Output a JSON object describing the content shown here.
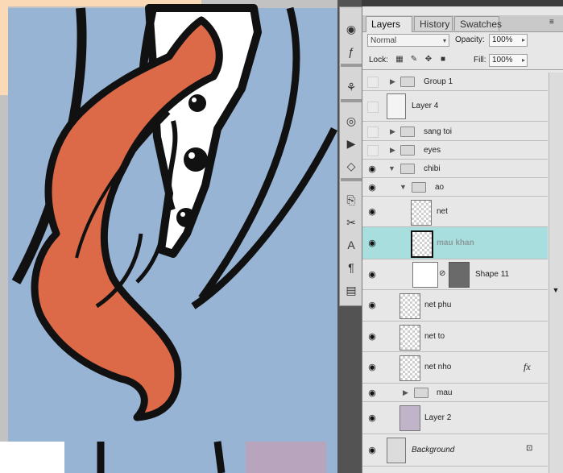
{
  "tabs": [
    {
      "label": "Layers",
      "close": "×"
    },
    {
      "label": "History"
    },
    {
      "label": "Swatches"
    }
  ],
  "options": {
    "blend_mode": "Normal",
    "opacity_label": "Opacity:",
    "opacity_value": "100%",
    "lock_label": "Lock:",
    "fill_label": "Fill:",
    "fill_value": "100%"
  },
  "layers": [
    {
      "name": "Group 1",
      "type": "group",
      "visible": false
    },
    {
      "name": "Layer 4",
      "type": "layer",
      "visible": false
    },
    {
      "name": "sang toi",
      "type": "group",
      "visible": false
    },
    {
      "name": "eyes",
      "type": "group",
      "visible": false
    },
    {
      "name": "chibi",
      "type": "group",
      "visible": true,
      "expanded": true
    },
    {
      "name": "ao",
      "type": "group",
      "visible": true,
      "expanded": true
    },
    {
      "name": "net",
      "type": "layer",
      "visible": true
    },
    {
      "name": "mau khan",
      "type": "layer",
      "visible": true,
      "selected": true
    },
    {
      "name": "Shape 11",
      "type": "shape",
      "visible": true
    },
    {
      "name": "net phu",
      "type": "layer",
      "visible": true
    },
    {
      "name": "net to",
      "type": "layer",
      "visible": true
    },
    {
      "name": "net nho",
      "type": "layer",
      "visible": true,
      "fx": "fx"
    },
    {
      "name": "mau",
      "type": "group",
      "visible": true
    },
    {
      "name": "Layer 2",
      "type": "layer",
      "visible": true
    },
    {
      "name": "Background",
      "type": "background",
      "visible": true,
      "locked": true
    }
  ],
  "colors": {
    "canvas_bg": "#98b4d4",
    "scarf": "#dc6a48",
    "outline": "#111111",
    "selected_row": "#a8dede",
    "panel_bg": "#e7e7e7"
  }
}
